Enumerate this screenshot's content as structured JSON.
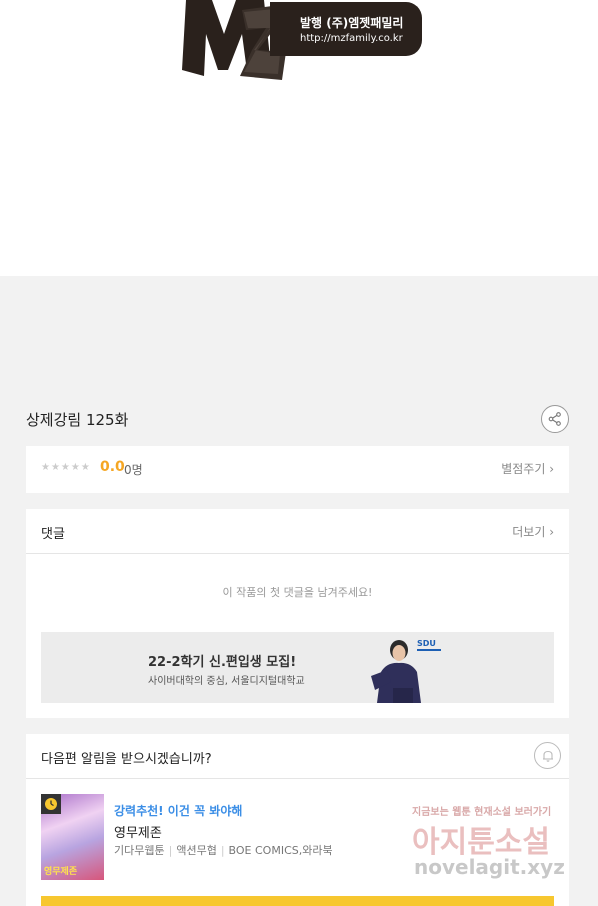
{
  "logo": {
    "mark": "MZ",
    "publisher": "발행 (주)엠젯패밀리",
    "url": "http://mzfamily.co.kr"
  },
  "episode": {
    "title": "상제강림 125화",
    "share_icon": "share-icon"
  },
  "rating": {
    "stars": "★★★★★",
    "star_fill_fraction": 0,
    "score": "0.0",
    "count": "0명",
    "rate_label": "별점주기 ›"
  },
  "comments": {
    "title": "댓글",
    "more_label": "더보기 ›",
    "empty_message": "이 작품의 첫 댓글을 남겨주세요!",
    "ad": {
      "title": "22-2학기 신.편입생 모집!",
      "subtitle": "사이버대학의 중심, 서울디지털대학교",
      "logo_text": "SDU"
    }
  },
  "notify": {
    "question": "다음편 알림을 받으시겠습니까?",
    "bell_icon": "bell-icon",
    "recommendation": {
      "tag": "강력추천! 이건 꼭 봐야해",
      "name": "영무제존",
      "meta": [
        "기다무웹툰",
        "액션무협",
        "BOE COMICS,와라북"
      ],
      "thumb_title": "영무제존",
      "clock_icon": "clock-icon"
    }
  },
  "watermark": {
    "small": "지금보는 웹툰 현재소설 보러가기",
    "big": "아지툰소설",
    "url": "novelagit.xyz"
  },
  "colors": {
    "accent_score": "#f5a623",
    "recommend_blue": "#3b8ee6",
    "cta_yellow": "#f7c72f",
    "logo_dark": "#2a211c"
  }
}
